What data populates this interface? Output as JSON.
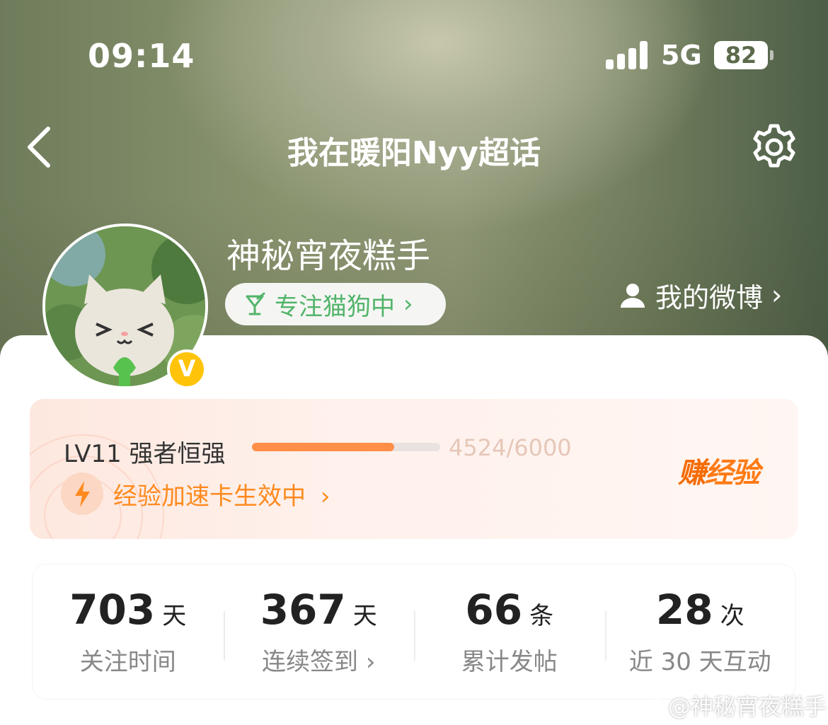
{
  "status_bar": {
    "time": "09:14",
    "network": "5G",
    "battery": "82"
  },
  "nav": {
    "back_icon": "chevron-left-icon",
    "title": "我在暖阳Nyy超话",
    "settings_icon": "gear-icon"
  },
  "profile": {
    "username": "神秘宵夜糕手",
    "verified_badge": "V",
    "status": "专注猫狗中",
    "status_chevron": "›",
    "my_weibo": "我的微博",
    "my_weibo_chevron": "›"
  },
  "level": {
    "label": "LV11 强者恒强",
    "progress_text": "4524/6000",
    "progress_fraction": 0.754,
    "boost_text": "经验加速卡生效中",
    "boost_chevron": "›",
    "earn_label_1": "赚",
    "earn_label_2": "经验"
  },
  "stats": [
    {
      "value": "703",
      "unit": "天",
      "label": "关注时间"
    },
    {
      "value": "367",
      "unit": "天",
      "label": "连续签到 ›"
    },
    {
      "value": "66",
      "unit": "条",
      "label": "累计发帖"
    },
    {
      "value": "28",
      "unit": "次",
      "label": "近 30 天互动"
    }
  ],
  "watermark": "@神秘宵夜糕手",
  "colors": {
    "accent_orange": "#ff8e48",
    "green": "#52b46a",
    "badge_yellow": "#ffc409"
  }
}
